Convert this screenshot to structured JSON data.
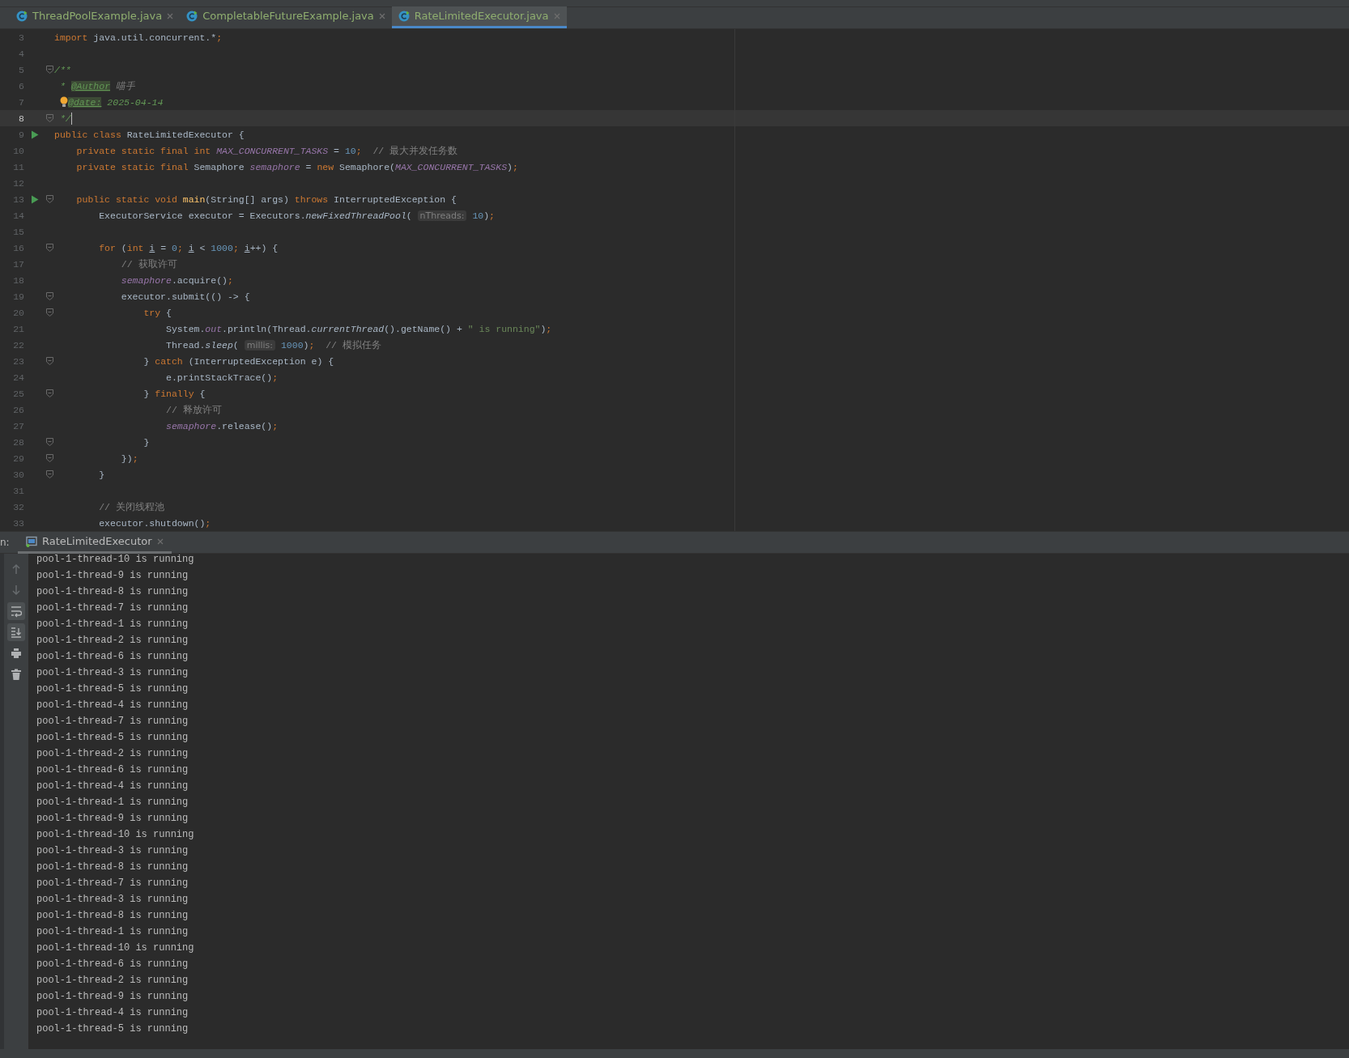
{
  "tabs": [
    {
      "label": "ThreadPoolExample.java",
      "selected": false
    },
    {
      "label": "CompletableFutureExample.java",
      "selected": false
    },
    {
      "label": "RateLimitedExecutor.java",
      "selected": true
    }
  ],
  "editor": {
    "lines": [
      {
        "number": "3",
        "current": false,
        "run": false,
        "fold": false,
        "tokens": [
          {
            "kind": "k",
            "text": "import "
          },
          {
            "kind": "p",
            "text": "java.util.concurrent.*"
          },
          {
            "kind": "k",
            "text": ";"
          }
        ]
      },
      {
        "number": "4",
        "current": false,
        "run": false,
        "fold": false
      },
      {
        "number": "5",
        "current": false,
        "run": false,
        "fold": true,
        "tokens": [
          {
            "kind": "d",
            "text": "/**"
          }
        ]
      },
      {
        "number": "6",
        "current": false,
        "run": false,
        "fold": false,
        "tokens": [
          {
            "kind": "d",
            "text": " * "
          },
          {
            "kind": "t",
            "text": "@Author"
          },
          {
            "kind": "g",
            "text": " 喵手"
          }
        ]
      },
      {
        "number": "7",
        "current": false,
        "run": false,
        "fold": false,
        "tokens": [
          {
            "kind": "bulb"
          },
          {
            "kind": "t",
            "text": "@date:"
          },
          {
            "kind": "v",
            "text": " 2025-04-14"
          }
        ]
      },
      {
        "number": "8",
        "current": true,
        "run": false,
        "fold": true,
        "tokens": [
          {
            "kind": "d",
            "text": " */"
          }
        ]
      },
      {
        "number": "9",
        "current": false,
        "run": true,
        "fold": false,
        "tokens": [
          {
            "kind": "k",
            "text": "public class "
          },
          {
            "kind": "p",
            "text": "RateLimitedExecutor {"
          }
        ]
      },
      {
        "number": "10",
        "current": false,
        "run": false,
        "fold": false,
        "tokens": [
          {
            "kind": "k",
            "text": "    private static final int "
          },
          {
            "kind": "f",
            "text": "MAX_CONCURRENT_TASKS"
          },
          {
            "kind": "p",
            "text": " = "
          },
          {
            "kind": "n",
            "text": "10"
          },
          {
            "kind": "k",
            "text": ";"
          },
          {
            "kind": "c",
            "text": "  // 最大并发任务数"
          }
        ]
      },
      {
        "number": "11",
        "current": false,
        "run": false,
        "fold": false,
        "tokens": [
          {
            "kind": "k",
            "text": "    private static final "
          },
          {
            "kind": "p",
            "text": "Semaphore "
          },
          {
            "kind": "f",
            "text": "semaphore"
          },
          {
            "kind": "p",
            "text": " = "
          },
          {
            "kind": "k",
            "text": "new "
          },
          {
            "kind": "p",
            "text": "Semaphore("
          },
          {
            "kind": "f",
            "text": "MAX_CONCURRENT_TASKS"
          },
          {
            "kind": "p",
            "text": ")"
          },
          {
            "kind": "k",
            "text": ";"
          }
        ]
      },
      {
        "number": "12",
        "current": false,
        "run": false,
        "fold": false
      },
      {
        "number": "13",
        "current": false,
        "run": true,
        "fold": true,
        "tokens": [
          {
            "kind": "k",
            "text": "    public static void "
          },
          {
            "kind": "m",
            "text": "main"
          },
          {
            "kind": "p",
            "text": "(String[] args) "
          },
          {
            "kind": "k",
            "text": "throws "
          },
          {
            "kind": "p",
            "text": "InterruptedException {"
          }
        ]
      },
      {
        "number": "14",
        "current": false,
        "run": false,
        "fold": false,
        "tokens": [
          {
            "kind": "p",
            "text": "        ExecutorService executor = Executors."
          },
          {
            "kind": "i",
            "text": "newFixedThreadPool"
          },
          {
            "kind": "p",
            "text": "( "
          },
          {
            "kind": "h",
            "text": "nThreads:"
          },
          {
            "kind": "n",
            "text": " 10"
          },
          {
            "kind": "p",
            "text": ")"
          },
          {
            "kind": "k",
            "text": ";"
          }
        ]
      },
      {
        "number": "15",
        "current": false,
        "run": false,
        "fold": false
      },
      {
        "number": "16",
        "current": false,
        "run": false,
        "fold": true,
        "tokens": [
          {
            "kind": "k",
            "text": "        for "
          },
          {
            "kind": "p",
            "text": "("
          },
          {
            "kind": "k",
            "text": "int "
          },
          {
            "kind": "u",
            "text": "i"
          },
          {
            "kind": "p",
            "text": " = "
          },
          {
            "kind": "n",
            "text": "0"
          },
          {
            "kind": "k",
            "text": "; "
          },
          {
            "kind": "u",
            "text": "i"
          },
          {
            "kind": "p",
            "text": " < "
          },
          {
            "kind": "n",
            "text": "1000"
          },
          {
            "kind": "k",
            "text": "; "
          },
          {
            "kind": "u",
            "text": "i"
          },
          {
            "kind": "p",
            "text": "++) {"
          }
        ]
      },
      {
        "number": "17",
        "current": false,
        "run": false,
        "fold": false,
        "tokens": [
          {
            "kind": "c",
            "text": "            // 获取许可"
          }
        ]
      },
      {
        "number": "18",
        "current": false,
        "run": false,
        "fold": false,
        "tokens": [
          {
            "kind": "f",
            "text": "            semaphore"
          },
          {
            "kind": "p",
            "text": ".acquire()"
          },
          {
            "kind": "k",
            "text": ";"
          }
        ]
      },
      {
        "number": "19",
        "current": false,
        "run": false,
        "fold": true,
        "tokens": [
          {
            "kind": "p",
            "text": "            executor.submit(() -> {"
          }
        ]
      },
      {
        "number": "20",
        "current": false,
        "run": false,
        "fold": true,
        "tokens": [
          {
            "kind": "k",
            "text": "                try "
          },
          {
            "kind": "p",
            "text": "{"
          }
        ]
      },
      {
        "number": "21",
        "current": false,
        "run": false,
        "fold": false,
        "tokens": [
          {
            "kind": "p",
            "text": "                    System."
          },
          {
            "kind": "f",
            "text": "out"
          },
          {
            "kind": "p",
            "text": ".println(Thread."
          },
          {
            "kind": "i",
            "text": "currentThread"
          },
          {
            "kind": "p",
            "text": "().getName() + "
          },
          {
            "kind": "s",
            "text": "\" is running\""
          },
          {
            "kind": "p",
            "text": ")"
          },
          {
            "kind": "k",
            "text": ";"
          }
        ]
      },
      {
        "number": "22",
        "current": false,
        "run": false,
        "fold": false,
        "tokens": [
          {
            "kind": "p",
            "text": "                    Thread."
          },
          {
            "kind": "i",
            "text": "sleep"
          },
          {
            "kind": "p",
            "text": "( "
          },
          {
            "kind": "h",
            "text": "millis:"
          },
          {
            "kind": "n",
            "text": " 1000"
          },
          {
            "kind": "p",
            "text": ")"
          },
          {
            "kind": "k",
            "text": ";"
          },
          {
            "kind": "c",
            "text": "  // 模拟任务"
          }
        ]
      },
      {
        "number": "23",
        "current": false,
        "run": false,
        "fold": true,
        "tokens": [
          {
            "kind": "p",
            "text": "                } "
          },
          {
            "kind": "k",
            "text": "catch "
          },
          {
            "kind": "p",
            "text": "(InterruptedException e) {"
          }
        ]
      },
      {
        "number": "24",
        "current": false,
        "run": false,
        "fold": false,
        "tokens": [
          {
            "kind": "p",
            "text": "                    e.printStackTrace()"
          },
          {
            "kind": "k",
            "text": ";"
          }
        ]
      },
      {
        "number": "25",
        "current": false,
        "run": false,
        "fold": true,
        "tokens": [
          {
            "kind": "p",
            "text": "                } "
          },
          {
            "kind": "k",
            "text": "finally "
          },
          {
            "kind": "p",
            "text": "{"
          }
        ]
      },
      {
        "number": "26",
        "current": false,
        "run": false,
        "fold": false,
        "tokens": [
          {
            "kind": "c",
            "text": "                    // 释放许可"
          }
        ]
      },
      {
        "number": "27",
        "current": false,
        "run": false,
        "fold": false,
        "tokens": [
          {
            "kind": "f",
            "text": "                    semaphore"
          },
          {
            "kind": "p",
            "text": ".release()"
          },
          {
            "kind": "k",
            "text": ";"
          }
        ]
      },
      {
        "number": "28",
        "current": false,
        "run": false,
        "fold": true,
        "tokens": [
          {
            "kind": "p",
            "text": "                }"
          }
        ]
      },
      {
        "number": "29",
        "current": false,
        "run": false,
        "fold": true,
        "tokens": [
          {
            "kind": "p",
            "text": "            })"
          },
          {
            "kind": "k",
            "text": ";"
          }
        ]
      },
      {
        "number": "30",
        "current": false,
        "run": false,
        "fold": true,
        "tokens": [
          {
            "kind": "p",
            "text": "        }"
          }
        ]
      },
      {
        "number": "31",
        "current": false,
        "run": false,
        "fold": false
      },
      {
        "number": "32",
        "current": false,
        "run": false,
        "fold": false,
        "tokens": [
          {
            "kind": "c",
            "text": "        // 关闭线程池"
          }
        ]
      },
      {
        "number": "33",
        "current": false,
        "run": false,
        "fold": false,
        "tokens": [
          {
            "kind": "p",
            "text": "        executor.shutdown()"
          },
          {
            "kind": "k",
            "text": ";"
          }
        ]
      }
    ]
  },
  "run_panel": {
    "label": "n:",
    "tab": {
      "label": "RateLimitedExecutor",
      "selected": true
    },
    "toolbar": [
      {
        "kind": "up",
        "active": false,
        "disabled": true
      },
      {
        "kind": "down",
        "active": false,
        "disabled": true
      },
      {
        "kind": "wrap",
        "active": true,
        "disabled": false
      },
      {
        "kind": "scroll-end",
        "active": true,
        "disabled": false
      },
      {
        "kind": "print",
        "active": false,
        "disabled": false
      },
      {
        "kind": "trash",
        "active": false,
        "disabled": false
      }
    ],
    "output": [
      "pool-1-thread-10 is running",
      "pool-1-thread-9 is running",
      "pool-1-thread-8 is running",
      "pool-1-thread-7 is running",
      "pool-1-thread-1 is running",
      "pool-1-thread-2 is running",
      "pool-1-thread-6 is running",
      "pool-1-thread-3 is running",
      "pool-1-thread-5 is running",
      "pool-1-thread-4 is running",
      "pool-1-thread-7 is running",
      "pool-1-thread-5 is running",
      "pool-1-thread-2 is running",
      "pool-1-thread-6 is running",
      "pool-1-thread-4 is running",
      "pool-1-thread-1 is running",
      "pool-1-thread-9 is running",
      "pool-1-thread-10 is running",
      "pool-1-thread-3 is running",
      "pool-1-thread-8 is running",
      "pool-1-thread-7 is running",
      "pool-1-thread-3 is running",
      "pool-1-thread-8 is running",
      "pool-1-thread-1 is running",
      "pool-1-thread-10 is running",
      "pool-1-thread-6 is running",
      "pool-1-thread-2 is running",
      "pool-1-thread-9 is running",
      "pool-1-thread-4 is running",
      "pool-1-thread-5 is running"
    ]
  }
}
